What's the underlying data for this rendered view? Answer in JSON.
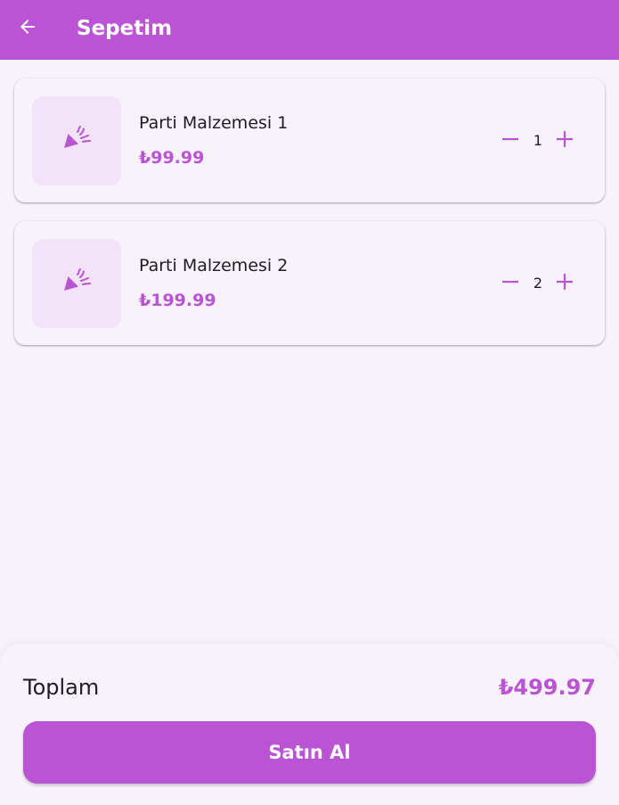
{
  "appbar": {
    "title": "Sepetim",
    "back_icon": "arrow-back-icon",
    "background": "#ba53d4"
  },
  "cart": {
    "items": [
      {
        "name": "Parti Malzemesi 1",
        "price": "₺99.99",
        "quantity": "1",
        "icon": "party-popper-icon"
      },
      {
        "name": "Parti Malzemesi 2",
        "price": "₺199.99",
        "quantity": "2",
        "icon": "party-popper-icon"
      }
    ]
  },
  "summary": {
    "total_label": "Toplam",
    "total_value": "₺499.97",
    "buy_label": "Satın Al"
  },
  "colors": {
    "accent": "#ba53d4",
    "background": "#f8f2fd",
    "thumb_background": "#f2e3f8",
    "text": "#1f1b23"
  }
}
